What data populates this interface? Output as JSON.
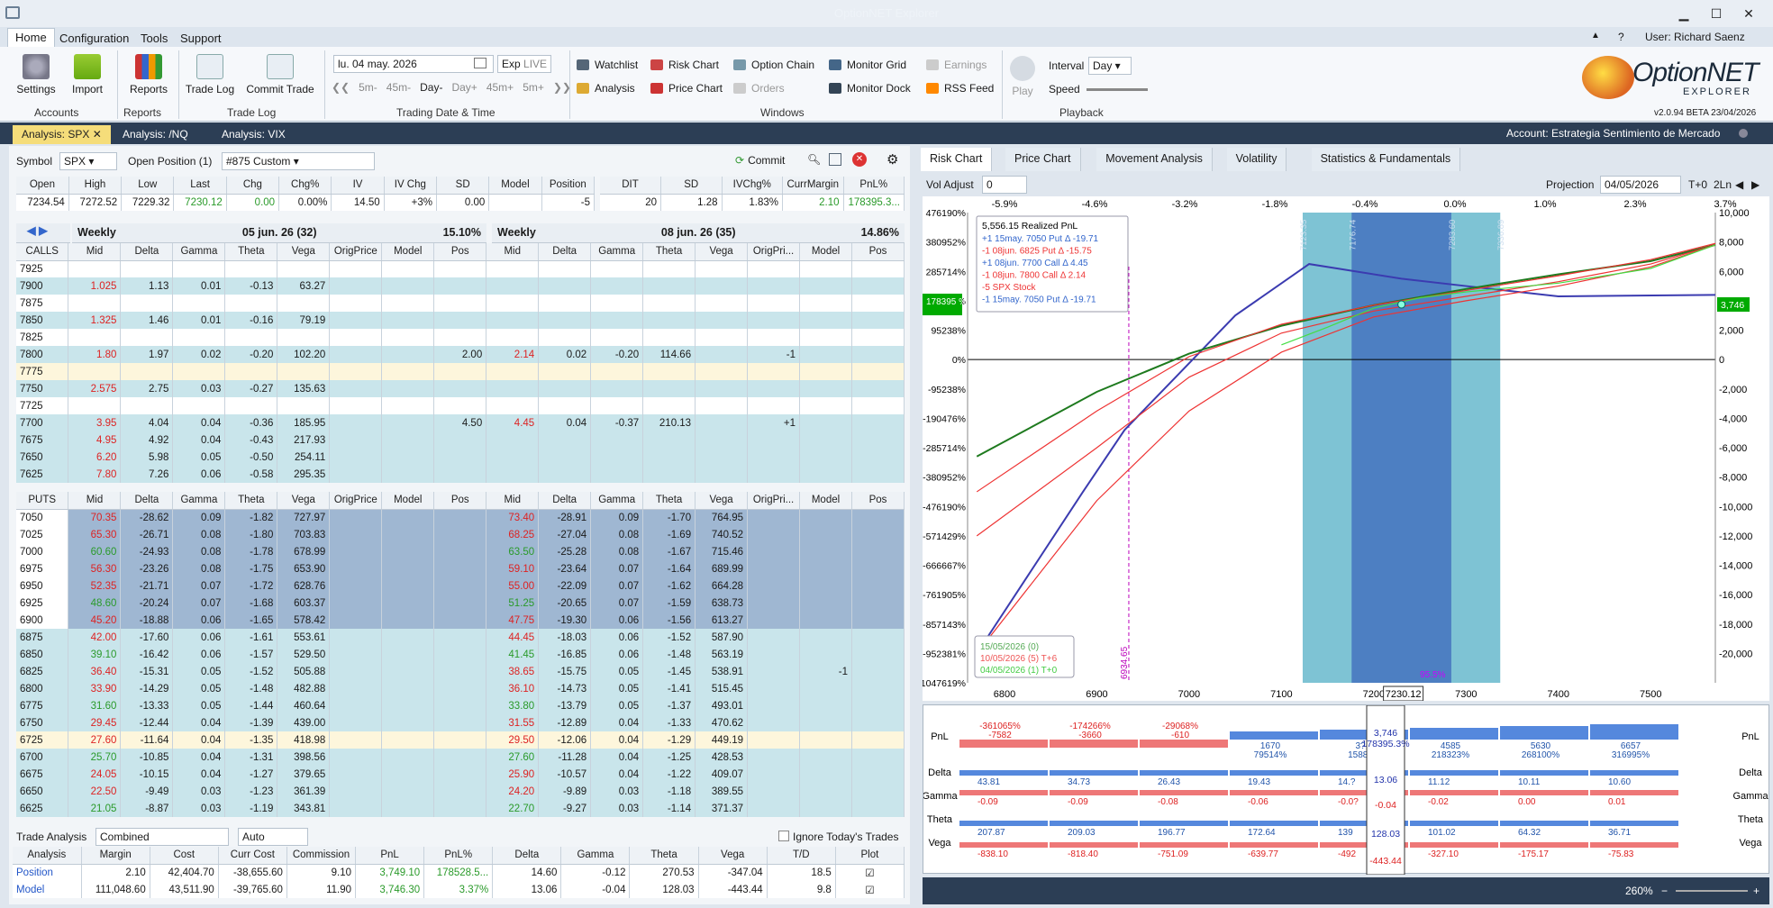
{
  "app": {
    "title": "OptionNET Explorer",
    "user": "User: Richard Saenz",
    "version": "v2.0.94 BETA 23/04/2026",
    "logo_line1": "OptionNET",
    "logo_line2": "EXPLORER"
  },
  "menu": [
    "Home",
    "Configuration",
    "Tools",
    "Support"
  ],
  "ribbon": {
    "accounts": {
      "label": "Accounts",
      "settings": "Settings",
      "import": "Import"
    },
    "reports": {
      "label": "Reports",
      "reports": "Reports"
    },
    "tradelog": {
      "label": "Trade Log",
      "tradelog": "Trade Log",
      "commit": "Commit Trade"
    },
    "date": {
      "label": "Trading Date & Time",
      "date": "lu. 04 may. 2026",
      "exp": "Exp",
      "live": "LIVE",
      "steps": [
        "5m-",
        "45m-",
        "Day-",
        "Day+",
        "45m+",
        "5m+"
      ]
    },
    "windows": {
      "label": "Windows",
      "items": [
        "Watchlist",
        "Risk Chart",
        "Option Chain",
        "Monitor Grid",
        "Earnings",
        "Analysis",
        "Price Chart",
        "Orders",
        "Monitor Dock",
        "RSS Feed"
      ]
    },
    "playback": {
      "label": "Playback",
      "play": "Play",
      "interval_label": "Interval",
      "interval": "Day",
      "speed_label": "Speed"
    }
  },
  "analysis_tabs": [
    "Analysis: SPX",
    "Analysis: /NQ",
    "Analysis: VIX"
  ],
  "account": "Account: Estrategia Sentimiento de Mercado",
  "symbol": {
    "label": "Symbol",
    "value": "SPX",
    "open_label": "Open Position (1)",
    "position": "#875 Custom",
    "commit": "Commit"
  },
  "quote": {
    "headers": [
      "Open",
      "High",
      "Low",
      "Last",
      "Chg",
      "Chg%",
      "IV",
      "IV Chg",
      "SD",
      "Model",
      "Position"
    ],
    "values": [
      "7234.54",
      "7272.52",
      "7229.32",
      "7230.12",
      "0.00",
      "0.00%",
      "14.50",
      "+3%",
      "0.00",
      "",
      "-5"
    ],
    "headers2": [
      "DIT",
      "SD",
      "IVChg%",
      "CurrMargin",
      "PnL%"
    ],
    "values2": [
      "20",
      "1.28",
      "1.83%",
      "2.10",
      "178395.3..."
    ]
  },
  "chain": {
    "left_hdr": {
      "name": "Weekly",
      "exp": "05 jun. 26 (32)",
      "iv": "15.10%"
    },
    "right_hdr": {
      "name": "Weekly",
      "exp": "08 jun. 26 (35)",
      "iv": "14.86%"
    },
    "cols": [
      "Mid",
      "Delta",
      "Gamma",
      "Theta",
      "Vega",
      "OrigPrice",
      "Model",
      "Pos"
    ],
    "rcols": [
      "Mid",
      "Delta",
      "Gamma",
      "Theta",
      "Vega",
      "OrigPri...",
      "Model",
      "Pos"
    ],
    "calls_label": "CALLS",
    "puts_label": "PUTS",
    "calls": [
      [
        "7925",
        "",
        "",
        "",
        "",
        "",
        "",
        ""
      ],
      [
        "7900",
        "1.025",
        "1.13",
        "0.01",
        "-0.13",
        "63.27",
        "",
        "",
        "",
        "",
        "",
        "",
        "",
        "",
        "",
        ""
      ],
      [
        "7875",
        "",
        "",
        "",
        "",
        "",
        "",
        "",
        "",
        "",
        "",
        "",
        "",
        "",
        "",
        ""
      ],
      [
        "7850",
        "1.325",
        "1.46",
        "0.01",
        "-0.16",
        "79.19",
        "",
        "",
        "",
        "",
        "",
        "",
        "",
        "",
        "",
        ""
      ],
      [
        "7825",
        "",
        "",
        "",
        "",
        "",
        "",
        "",
        "",
        "",
        "",
        "",
        "",
        "",
        "",
        ""
      ],
      [
        "7800",
        "1.80",
        "1.97",
        "0.02",
        "-0.20",
        "102.20",
        "",
        "",
        "2.00",
        "2.14",
        "0.02",
        "-0.20",
        "114.66",
        "",
        "-1",
        ""
      ],
      [
        "7775",
        "",
        "",
        "",
        "",
        "",
        "",
        "",
        "",
        "",
        "",
        "",
        "",
        "",
        "",
        ""
      ],
      [
        "7750",
        "2.575",
        "2.75",
        "0.03",
        "-0.27",
        "135.63",
        "",
        "",
        "",
        "",
        "",
        "",
        "",
        "",
        "",
        ""
      ],
      [
        "7725",
        "",
        "",
        "",
        "",
        "",
        "",
        "",
        "",
        "",
        "",
        "",
        "",
        "",
        "",
        ""
      ],
      [
        "7700",
        "3.95",
        "4.04",
        "0.04",
        "-0.36",
        "185.95",
        "",
        "",
        "4.50",
        "4.45",
        "0.04",
        "-0.37",
        "210.13",
        "",
        "+1",
        ""
      ],
      [
        "7675",
        "4.95",
        "4.92",
        "0.04",
        "-0.43",
        "217.93",
        "",
        "",
        "",
        "",
        "",
        "",
        "",
        "",
        "",
        ""
      ],
      [
        "7650",
        "6.20",
        "5.98",
        "0.05",
        "-0.50",
        "254.11",
        "",
        "",
        "",
        "",
        "",
        "",
        "",
        "",
        "",
        ""
      ],
      [
        "7625",
        "7.80",
        "7.26",
        "0.06",
        "-0.58",
        "295.35",
        "",
        "",
        "",
        "",
        "",
        "",
        "",
        "",
        "",
        ""
      ]
    ],
    "puts": [
      [
        "7050",
        "70.35",
        "-28.62",
        "0.09",
        "-1.82",
        "727.97",
        "73.40",
        "-28.91",
        "0.09",
        "-1.70",
        "764.95",
        ""
      ],
      [
        "7025",
        "65.30",
        "-26.71",
        "0.08",
        "-1.80",
        "703.83",
        "68.25",
        "-27.04",
        "0.08",
        "-1.69",
        "740.52",
        ""
      ],
      [
        "7000",
        "60.60",
        "-24.93",
        "0.08",
        "-1.78",
        "678.99",
        "63.50",
        "-25.28",
        "0.08",
        "-1.67",
        "715.46",
        ""
      ],
      [
        "6975",
        "56.30",
        "-23.26",
        "0.08",
        "-1.75",
        "653.90",
        "59.10",
        "-23.64",
        "0.07",
        "-1.64",
        "689.99",
        ""
      ],
      [
        "6950",
        "52.35",
        "-21.71",
        "0.07",
        "-1.72",
        "628.76",
        "55.00",
        "-22.09",
        "0.07",
        "-1.62",
        "664.28",
        ""
      ],
      [
        "6925",
        "48.60",
        "-20.24",
        "0.07",
        "-1.68",
        "603.37",
        "51.25",
        "-20.65",
        "0.07",
        "-1.59",
        "638.73",
        ""
      ],
      [
        "6900",
        "45.20",
        "-18.88",
        "0.06",
        "-1.65",
        "578.42",
        "47.75",
        "-19.30",
        "0.06",
        "-1.56",
        "613.27",
        ""
      ],
      [
        "6875",
        "42.00",
        "-17.60",
        "0.06",
        "-1.61",
        "553.61",
        "44.45",
        "-18.03",
        "0.06",
        "-1.52",
        "587.90",
        ""
      ],
      [
        "6850",
        "39.10",
        "-16.42",
        "0.06",
        "-1.57",
        "529.50",
        "41.45",
        "-16.85",
        "0.06",
        "-1.48",
        "563.19",
        ""
      ],
      [
        "6825",
        "36.40",
        "-15.31",
        "0.05",
        "-1.52",
        "505.88",
        "38.65",
        "-15.75",
        "0.05",
        "-1.45",
        "538.91",
        "-1"
      ],
      [
        "6800",
        "33.90",
        "-14.29",
        "0.05",
        "-1.48",
        "482.88",
        "36.10",
        "-14.73",
        "0.05",
        "-1.41",
        "515.45",
        ""
      ],
      [
        "6775",
        "31.60",
        "-13.33",
        "0.05",
        "-1.44",
        "460.64",
        "33.80",
        "-13.79",
        "0.05",
        "-1.37",
        "493.01",
        ""
      ],
      [
        "6750",
        "29.45",
        "-12.44",
        "0.04",
        "-1.39",
        "439.00",
        "31.55",
        "-12.89",
        "0.04",
        "-1.33",
        "470.62",
        ""
      ],
      [
        "6725",
        "27.60",
        "-11.64",
        "0.04",
        "-1.35",
        "418.98",
        "29.50",
        "-12.06",
        "0.04",
        "-1.29",
        "449.19",
        ""
      ],
      [
        "6700",
        "25.70",
        "-10.85",
        "0.04",
        "-1.31",
        "398.56",
        "27.60",
        "-11.28",
        "0.04",
        "-1.25",
        "428.53",
        ""
      ],
      [
        "6675",
        "24.05",
        "-10.15",
        "0.04",
        "-1.27",
        "379.65",
        "25.90",
        "-10.57",
        "0.04",
        "-1.22",
        "409.07",
        ""
      ],
      [
        "6650",
        "22.50",
        "-9.49",
        "0.03",
        "-1.23",
        "361.39",
        "24.20",
        "-9.89",
        "0.03",
        "-1.18",
        "389.55",
        ""
      ],
      [
        "6625",
        "21.05",
        "-8.87",
        "0.03",
        "-1.19",
        "343.81",
        "22.70",
        "-9.27",
        "0.03",
        "-1.14",
        "371.37",
        ""
      ]
    ]
  },
  "trade_analysis": {
    "label": "Trade Analysis",
    "mode": "Combined",
    "auto": "Auto",
    "ignore": "Ignore Today's Trades",
    "headers": [
      "Analysis",
      "Margin",
      "Cost",
      "Curr Cost",
      "Commission",
      "PnL",
      "PnL%",
      "Delta",
      "Gamma",
      "Theta",
      "Vega",
      "T/D",
      "Plot"
    ],
    "rows": [
      [
        "Position",
        "2.10",
        "42,404.70",
        "-38,655.60",
        "9.10",
        "3,749.10",
        "178528.5...",
        "14.60",
        "-0.12",
        "270.53",
        "-347.04",
        "18.5"
      ],
      [
        "Model",
        "111,048.60",
        "43,511.90",
        "-39,765.60",
        "11.90",
        "3,746.30",
        "3.37%",
        "13.06",
        "-0.04",
        "128.03",
        "-443.44",
        "9.8"
      ]
    ]
  },
  "right": {
    "tabs": [
      "Risk Chart",
      "Price Chart",
      "Movement Analysis",
      "Volatility",
      "Statistics & Fundamentals"
    ],
    "vol_label": "Vol Adjust",
    "vol": "0",
    "proj_label": "Projection",
    "proj": "04/05/2026",
    "t0": "T+0",
    "ln": "2Ln",
    "pct_ticks": [
      "-5.9%",
      "-4.6%",
      "-3.2%",
      "-1.8%",
      "-0.4%",
      "0.0%",
      "1.0%",
      "2.3%",
      "3.7%"
    ],
    "legend": {
      "title": "5,556.15 Realized PnL",
      "items": [
        "+1 15may. 7050 Put Δ  -19.71",
        "-1 08jun. 6825 Put Δ  -15.75",
        "+1 08jun. 7700 Call Δ  4.45",
        "-1 08jun. 7800 Call Δ  2.14",
        "-5 SPX Stock",
        "-1 15may. 7050 Put Δ  -19.71"
      ]
    },
    "dates": [
      "15/05/2026 (0)",
      "10/05/2026 (5) T+6",
      "04/05/2026 (1) T+0"
    ],
    "marker_left": "6934.65",
    "marker_pct": "4.6%",
    "band_pct": "95.5%",
    "band_labels": [
      "7123.35",
      "7176.74",
      "7283.60",
      "7336.89"
    ],
    "pnl_tag": "178395 %",
    "pnl_right": "3,746",
    "current": "7230.12",
    "zoom": "260%"
  },
  "chart_data": {
    "type": "line",
    "title": "Risk Chart",
    "x_ticks": [
      6800,
      6900,
      7000,
      7100,
      7200,
      7300,
      7400,
      7500
    ],
    "y_right": [
      10000,
      8000,
      6000,
      4000,
      2000,
      0,
      -2000,
      -4000,
      -6000,
      -8000,
      -10000,
      -12000,
      -14000,
      -16000,
      -18000,
      -20000
    ],
    "y_left": [
      "476190%",
      "380952%",
      "285714%",
      "190476%",
      "95238%",
      "0%",
      "-95238%",
      "-190476%",
      "-285714%",
      "-380952%",
      "-476190%",
      "-571429%",
      "-666667%",
      "-761905%",
      "-857143%",
      "-952381%",
      "-1047619%"
    ],
    "xlim": [
      6760,
      7570
    ],
    "ylim": [
      -22000,
      10000
    ],
    "series": [
      {
        "color": "#3b3bb0",
        "x": [
          6770,
          6885,
          6930,
          6990,
          7050,
          7130,
          7230,
          7300,
          7400,
          7570
        ],
        "y": [
          -20000,
          -9000,
          -4800,
          -900,
          3000,
          6500,
          5500,
          5000,
          4300,
          4400
        ]
      },
      {
        "color": "#1e7a1e",
        "x": [
          6770,
          6900,
          7000,
          7100,
          7200,
          7300,
          7400,
          7500,
          7570
        ],
        "y": [
          -6600,
          -2200,
          400,
          2300,
          3700,
          4800,
          5800,
          6700,
          7800
        ]
      },
      {
        "color": "#e33",
        "x": [
          6770,
          6900,
          7000,
          7100,
          7200,
          7300,
          7400,
          7500,
          7570
        ],
        "y": [
          -9000,
          -3500,
          200,
          2400,
          3700,
          4700,
          5700,
          6800,
          7900
        ]
      },
      {
        "color": "#e33",
        "x": [
          6770,
          6900,
          7000,
          7100,
          7200,
          7300,
          7400,
          7500,
          7570
        ],
        "y": [
          -12000,
          -6000,
          -1200,
          1800,
          3300,
          4300,
          5300,
          6500,
          7800
        ]
      },
      {
        "color": "#e33",
        "x": [
          6770,
          6900,
          7000,
          7100,
          7200,
          7300,
          7400,
          7500,
          7570
        ],
        "y": [
          -20000,
          -9600,
          -3500,
          500,
          2900,
          4000,
          5000,
          6300,
          7800
        ]
      },
      {
        "color": "#4d4",
        "x": [
          7100,
          7150,
          7200,
          7250,
          7300,
          7400,
          7500,
          7570
        ],
        "y": [
          1000,
          2200,
          3500,
          4200,
          4600,
          5200,
          6200,
          7800
        ]
      }
    ]
  },
  "greeks": {
    "rows": [
      "PnL",
      "Delta",
      "Gamma",
      "Theta",
      "Vega"
    ],
    "pnl_neg": [
      "-361065%",
      "-174266%",
      "-29068%"
    ],
    "pnl_neg2": [
      "-7582",
      "-3660",
      "-610"
    ],
    "pnl_pos": [
      "1670",
      "3?",
      "4585",
      "5630",
      "6657"
    ],
    "pnl_pos2": [
      "79514%",
      "1588?",
      "218323%",
      "268100%",
      "316995%"
    ],
    "delta": [
      "43.81",
      "34.73",
      "26.43",
      "19.43",
      "14.?",
      "11.12",
      "10.11",
      "10.60"
    ],
    "gamma": [
      "-0.09",
      "-0.09",
      "-0.08",
      "-0.06",
      "-0.0?",
      "-0.02",
      "0.00",
      "0.01"
    ],
    "theta": [
      "207.87",
      "209.03",
      "196.77",
      "172.64",
      "139",
      "101.02",
      "64.32",
      "36.71"
    ],
    "vega": [
      "-838.10",
      "-818.40",
      "-751.09",
      "-639.77",
      "-492",
      "-327.10",
      "-175.17",
      "-75.83"
    ],
    "center": {
      "pnl": "3,746",
      "pnlp": "178395.3%",
      "delta": "13.06",
      "gamma": "-0.04",
      "theta": "128.03",
      "vega": "-443.44"
    }
  }
}
